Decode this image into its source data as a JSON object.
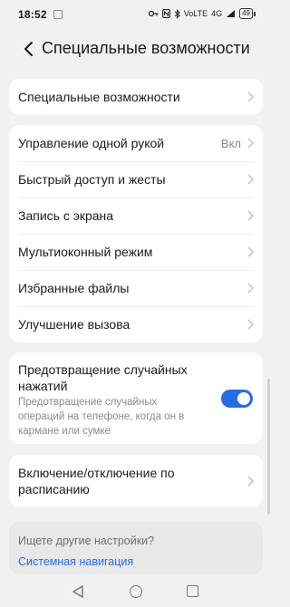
{
  "status_bar": {
    "time": "18:52",
    "icons": [
      "alarm-icon",
      "nfc-icon",
      "bluetooth-icon",
      "volte-icon",
      "signal-icon"
    ],
    "volte": "VoLTE",
    "network": "4G",
    "battery": "49"
  },
  "header": {
    "title": "Специальные возможности"
  },
  "card1": {
    "item": "Специальные возможности"
  },
  "card2": {
    "items": [
      {
        "label": "Управление одной рукой",
        "value": "Вкл"
      },
      {
        "label": "Быстрый доступ и жесты"
      },
      {
        "label": "Запись с экрана"
      },
      {
        "label": "Мультиоконный режим"
      },
      {
        "label": "Избранные файлы"
      },
      {
        "label": "Улучшение вызова"
      }
    ]
  },
  "card3": {
    "title": "Предотвращение случайных нажатий",
    "description": "Предотвращение случайных операций на телефоне, когда он в кармане или сумке",
    "toggle_on": true,
    "accent_color": "#2a6ae5"
  },
  "card4": {
    "title": "Включение/отключение по расписанию"
  },
  "suggestions": {
    "question": "Ищете другие настройки?",
    "link": "Системная навигация"
  },
  "nav": {
    "icons": [
      "back-triangle-icon",
      "home-circle-icon",
      "recents-square-icon"
    ]
  }
}
